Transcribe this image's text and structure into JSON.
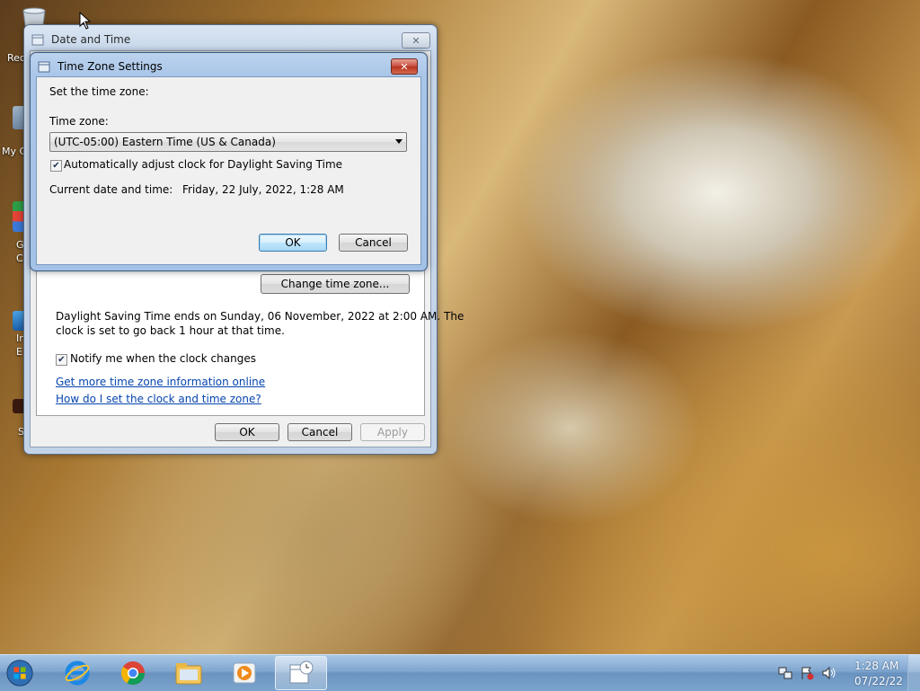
{
  "desktop": {
    "icons": [
      {
        "label": "Rec",
        "icon": "recycle-bin-icon"
      },
      {
        "label": "My C",
        "icon": "computer-icon"
      },
      {
        "label": "G",
        "label2": "C",
        "icon": "chrome-shortcut-icon"
      },
      {
        "label": "Ir",
        "label2": "E",
        "icon": "ie-shortcut-icon"
      },
      {
        "label": "S",
        "icon": "shortcut-icon"
      }
    ]
  },
  "date_time_window": {
    "title": "Date and Time",
    "close": "✕",
    "change_time_zone_button": "Change time zone...",
    "dst_message": [
      "Daylight Saving Time ends on Sunday, 06 November, 2022 at 2:00 AM. The",
      "clock is set to go back 1 hour at that time."
    ],
    "notify_label": "Notify me when the clock changes",
    "notify_checked": true,
    "link_more_info": "Get more time zone information online",
    "link_how_to": "How do I set the clock and time zone?",
    "ok": "OK",
    "cancel": "Cancel",
    "apply": "Apply"
  },
  "time_zone_dialog": {
    "title": "Time Zone Settings",
    "close": "✕",
    "heading": "Set the time zone:",
    "time_zone_label": "Time zone:",
    "time_zone_value": "(UTC-05:00) Eastern Time (US & Canada)",
    "dst_label": "Automatically adjust clock for Daylight Saving Time",
    "dst_checked": true,
    "current_label": "Current date and time:",
    "current_value": "Friday, 22 July, 2022, 1:28 AM",
    "ok": "OK",
    "cancel": "Cancel"
  },
  "taskbar": {
    "clock_time": "1:28 AM",
    "clock_date": "07/22/22",
    "pinned": [
      "start-orb-icon",
      "internet-explorer-icon",
      "chrome-icon",
      "file-explorer-icon",
      "media-player-icon",
      "date-time-icon"
    ]
  },
  "colors": {
    "close_red": "#c74a3b",
    "link_blue": "#0645ad",
    "taskbar_blue": "#7fa6cf"
  }
}
